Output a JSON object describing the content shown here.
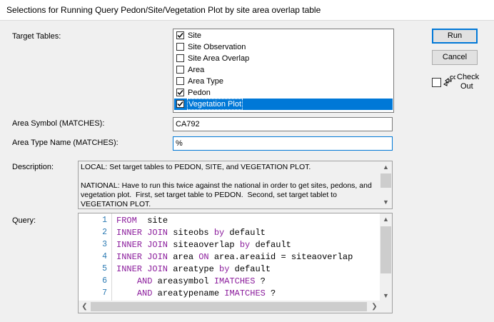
{
  "window": {
    "title": "Selections for Running Query Pedon/Site/Vegetation Plot by site area overlap table"
  },
  "labels": {
    "target_tables": "Target Tables:",
    "area_symbol": "Area Symbol (MATCHES):",
    "area_type_name": "Area Type Name (MATCHES):",
    "description": "Description:",
    "query": "Query:"
  },
  "target_tables": [
    {
      "label": "Site",
      "checked": true,
      "selected": false
    },
    {
      "label": "Site Observation",
      "checked": false,
      "selected": false
    },
    {
      "label": "Site Area Overlap",
      "checked": false,
      "selected": false
    },
    {
      "label": "Area",
      "checked": false,
      "selected": false
    },
    {
      "label": "Area Type",
      "checked": false,
      "selected": false
    },
    {
      "label": "Pedon",
      "checked": true,
      "selected": false
    },
    {
      "label": "Vegetation Plot",
      "checked": true,
      "selected": true
    }
  ],
  "buttons": {
    "run": "Run",
    "cancel": "Cancel"
  },
  "checkout": {
    "label_line1": "Check",
    "label_line2": "Out",
    "checked": false,
    "icon": "checkout-icon"
  },
  "fields": {
    "area_symbol": "CA792",
    "area_type_name": "%"
  },
  "description_text": "LOCAL: Set target tables to PEDON, SITE, and VEGETATION PLOT.\n\nNATIONAL: Have to run this twice against the national in order to get sites, pedons, and vegetation plot.  First, set target table to PEDON.  Second, set target tablet to VEGETATION PLOT.",
  "query_lines": [
    {
      "num": "1",
      "parts": [
        [
          "kw",
          "FROM"
        ],
        [
          "",
          "  site"
        ]
      ]
    },
    {
      "num": "2",
      "parts": [
        [
          "kw",
          "INNER JOIN"
        ],
        [
          "",
          " siteobs "
        ],
        [
          "kw",
          "by"
        ],
        [
          "",
          " default"
        ]
      ]
    },
    {
      "num": "3",
      "parts": [
        [
          "kw",
          "INNER JOIN"
        ],
        [
          "",
          " siteaoverlap "
        ],
        [
          "kw",
          "by"
        ],
        [
          "",
          " default"
        ]
      ]
    },
    {
      "num": "4",
      "parts": [
        [
          "kw",
          "INNER JOIN"
        ],
        [
          "",
          " area "
        ],
        [
          "kw",
          "ON"
        ],
        [
          "",
          " area.areaiid = siteaoverlap"
        ]
      ]
    },
    {
      "num": "5",
      "parts": [
        [
          "kw",
          "INNER JOIN"
        ],
        [
          "",
          " areatype "
        ],
        [
          "kw",
          "by"
        ],
        [
          "",
          " default"
        ]
      ]
    },
    {
      "num": "6",
      "parts": [
        [
          "",
          "    "
        ],
        [
          "kw",
          "AND"
        ],
        [
          "",
          " areasymbol "
        ],
        [
          "kw",
          "IMATCHES"
        ],
        [
          "",
          " ?"
        ]
      ]
    },
    {
      "num": "7",
      "parts": [
        [
          "",
          "    "
        ],
        [
          "kw",
          "AND"
        ],
        [
          "",
          " areatypename "
        ],
        [
          "kw",
          "IMATCHES"
        ],
        [
          "",
          " ?"
        ]
      ]
    }
  ]
}
